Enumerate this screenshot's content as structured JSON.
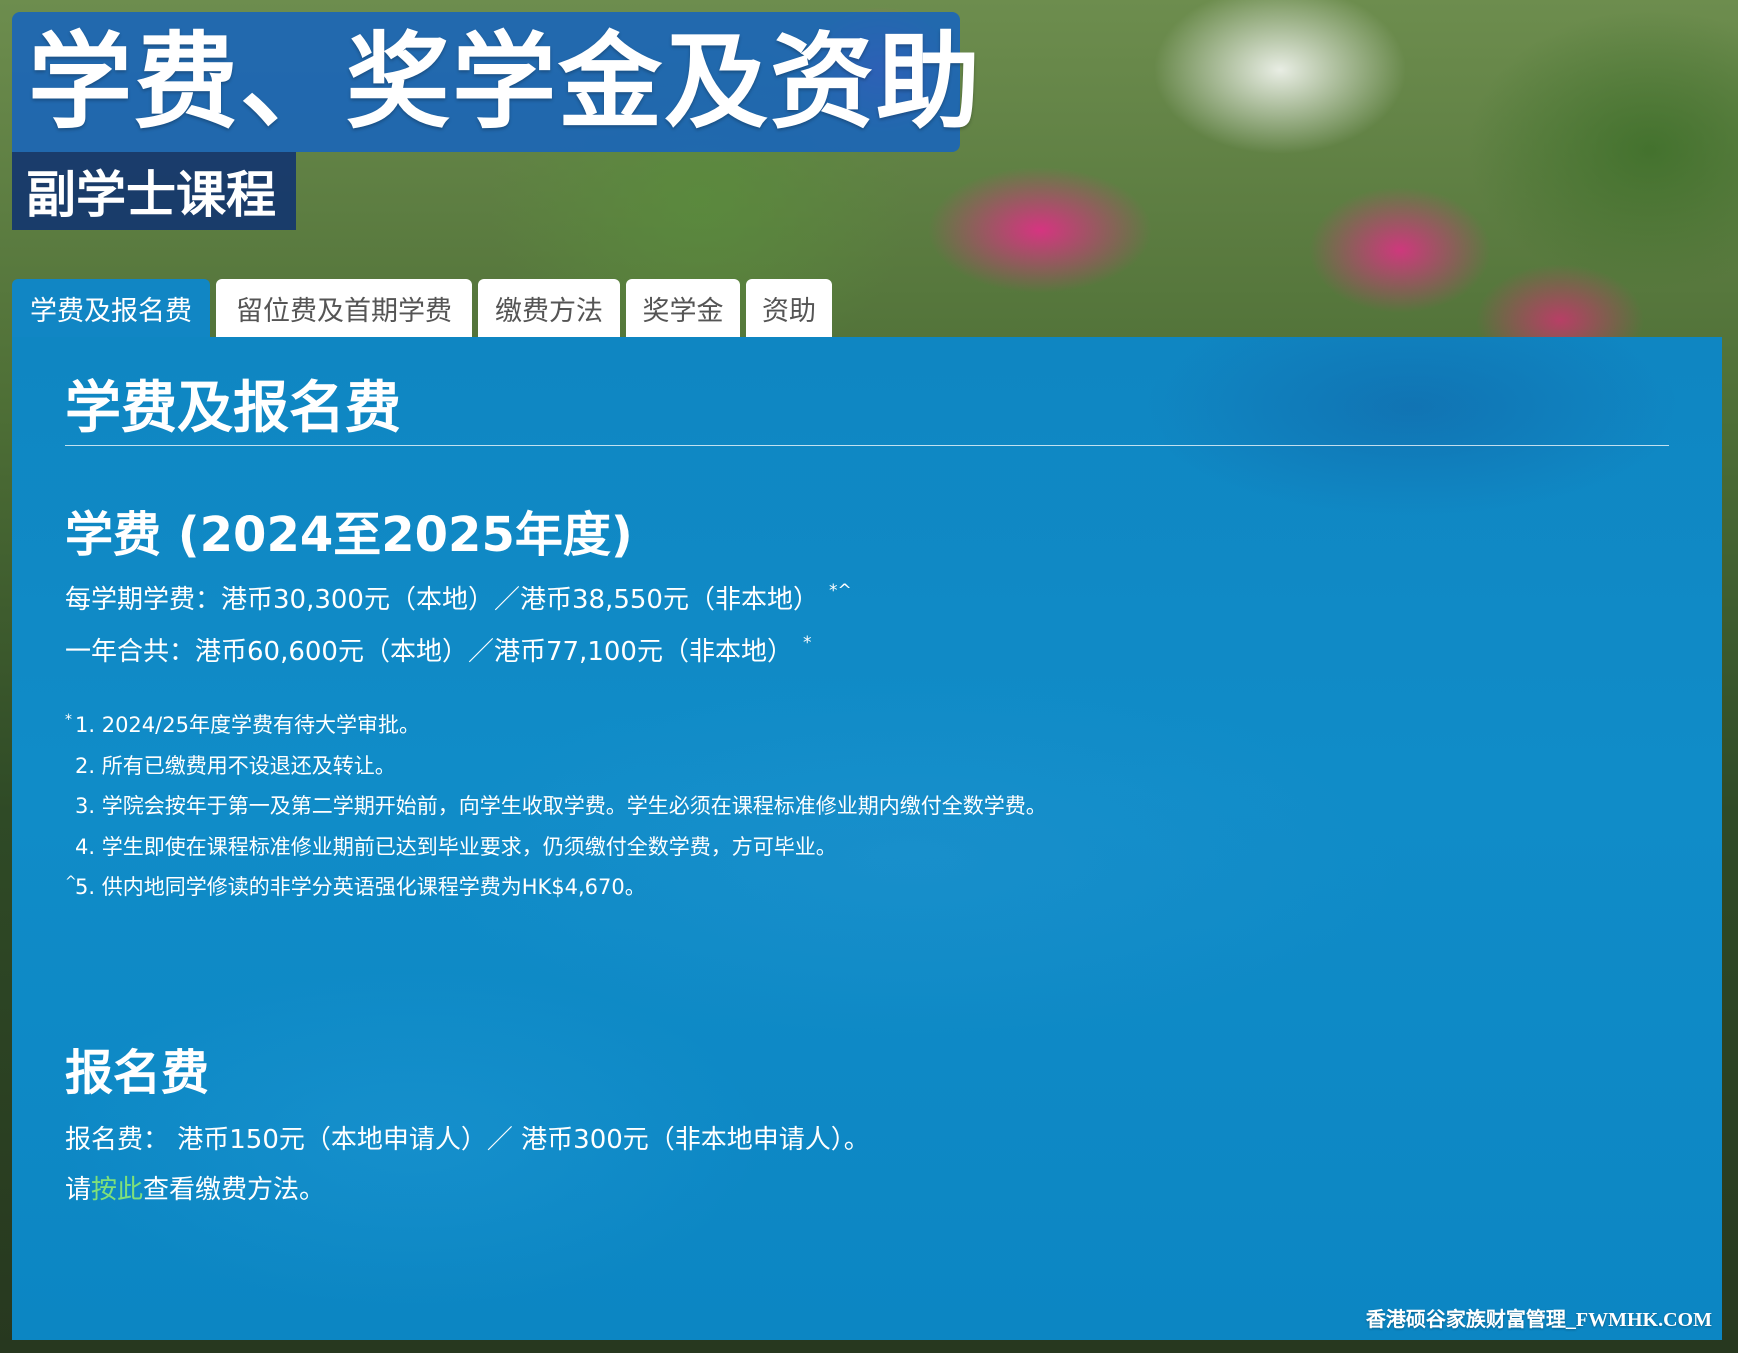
{
  "header": {
    "title": "学费、奖学金及资助",
    "subtitle": "副学士课程"
  },
  "tabs": [
    {
      "label": "学费及报名费",
      "active": true
    },
    {
      "label": "留位费及首期学费",
      "active": false
    },
    {
      "label": "缴费方法",
      "active": false
    },
    {
      "label": "奖学金",
      "active": false
    },
    {
      "label": "资助",
      "active": false
    }
  ],
  "panel": {
    "title": "学费及报名费",
    "tuition": {
      "heading": "学费 (2024至2025年度)",
      "per_semester": "每学期学费：港币30,300元（本地）／港币38,550元（非本地）",
      "per_semester_mark": "*^",
      "per_year": "一年合共：港币60,600元（本地）／港币77,100元（非本地）",
      "per_year_mark": "*",
      "notes": [
        {
          "mark": "*",
          "text": "1. 2024/25年度学费有待大学审批。"
        },
        {
          "mark": "",
          "text": "2. 所有已缴费用不设退还及转让。"
        },
        {
          "mark": "",
          "text": "3. 学院会按年于第一及第二学期开始前，向学生收取学费。学生必须在课程标准修业期内缴付全数学费。"
        },
        {
          "mark": "",
          "text": "4. 学生即使在课程标准修业期前已达到毕业要求，仍须缴付全数学费，方可毕业。"
        },
        {
          "mark": "^",
          "text": "5. 供内地同学修读的非学分英语强化课程学费为HK$4,670。"
        }
      ]
    },
    "registration": {
      "heading": "报名费",
      "fee_text": "报名费： 港币150元（本地申请人）／ 港币300元（非本地申请人）。",
      "link_prefix": "请",
      "link_text": "按此",
      "link_suffix": "查看缴费方法。"
    }
  },
  "watermark": "香港硕谷家族财富管理_FWMHK.COM",
  "colors": {
    "title_bg": "#1864bc",
    "subtitle_bg": "#14376e",
    "panel_bg": "#0f86c2",
    "active_tab_bg": "#1186c4",
    "link": "#7fe07a"
  }
}
